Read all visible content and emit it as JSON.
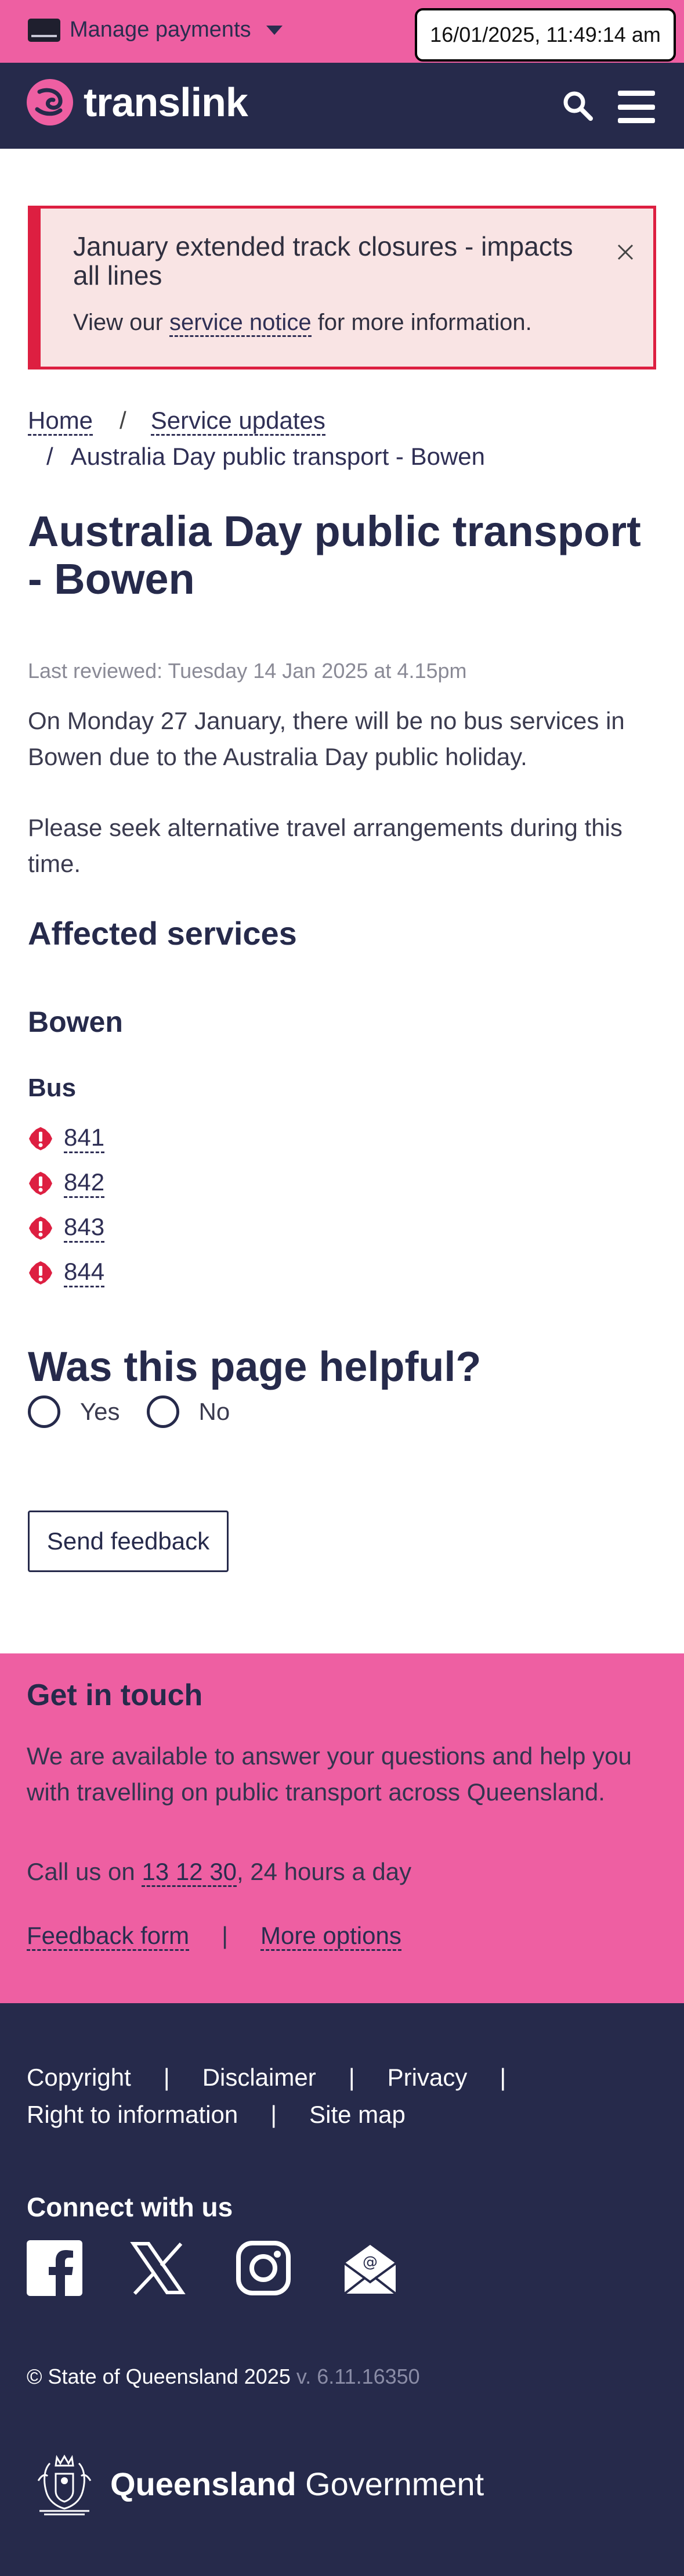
{
  "topbar": {
    "manage_payments": "Manage payments",
    "datetime": "16/01/2025, 11:49:14 am"
  },
  "header": {
    "brand": "translink"
  },
  "alert": {
    "title": "January extended track closures - impacts all lines",
    "body_prefix": "View our ",
    "body_link": "service notice",
    "body_suffix": " for more information."
  },
  "breadcrumb": {
    "items": [
      "Home",
      "Service updates",
      "Australia Day public transport - Bowen"
    ],
    "separator": "/"
  },
  "page": {
    "title": "Australia Day public transport - Bowen",
    "reviewed": "Last reviewed: Tuesday 14 Jan 2025 at 4.15pm",
    "para1": "On Monday 27 January, there will be no bus services in Bowen due to the Australia Day public holiday.",
    "para2": "Please seek alternative travel arrangements during this time.",
    "affected_heading": "Affected services",
    "region": "Bowen",
    "mode": "Bus",
    "routes": [
      "841",
      "842",
      "843",
      "844"
    ]
  },
  "feedback": {
    "question": "Was this page helpful?",
    "yes": "Yes",
    "no": "No",
    "send": "Send feedback"
  },
  "touch": {
    "title": "Get in touch",
    "text": "We are available to answer your questions and help you with travelling on public transport across Queensland.",
    "call_prefix": "Call us on ",
    "phone": "13 12 30",
    "call_suffix": ", 24 hours a day",
    "feedback_form": "Feedback form",
    "more_options": "More options",
    "separator": "|"
  },
  "footer": {
    "links": [
      "Copyright",
      "Disclaimer",
      "Privacy",
      "Right to information",
      "Site map"
    ],
    "separator": "|",
    "connect": "Connect with us",
    "social": [
      "facebook-icon",
      "x-icon",
      "instagram-icon",
      "email-icon"
    ],
    "copyright": "© State of Queensland 2025",
    "version": " v. 6.11.16350",
    "gov_bold": "Queensland",
    "gov_regular": " Government"
  },
  "colors": {
    "pink": "#ee5fa2",
    "navy": "#262a4b",
    "alert_red": "#dd1f41",
    "alert_bg": "#f9e4e4"
  }
}
